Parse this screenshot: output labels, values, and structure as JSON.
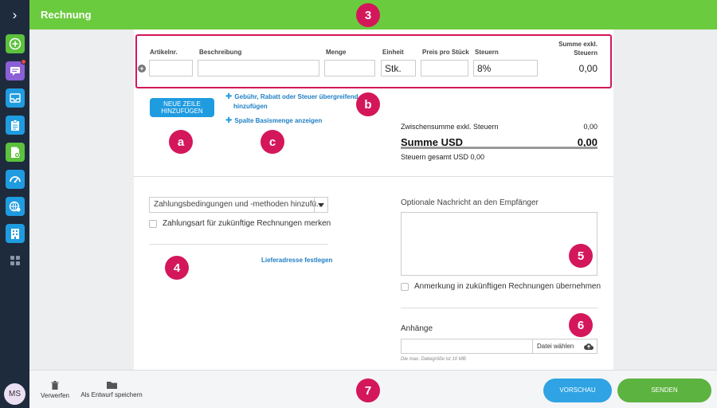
{
  "header": {
    "title": "Rechnung"
  },
  "sidebar": {
    "avatar_initials": "MS"
  },
  "line_items": {
    "columns": {
      "item_no": "Artikelnr.",
      "description": "Beschreibung",
      "quantity": "Menge",
      "unit": "Einheit",
      "unit_price": "Preis pro Stück",
      "tax": "Steuern",
      "sum_line1": "Summe exkl.",
      "sum_line2": "Steuern"
    },
    "row": {
      "item_no": "",
      "description": "",
      "quantity": "",
      "unit": "Stk.",
      "unit_price": "",
      "tax": "8%",
      "sum": "0,00"
    }
  },
  "actions": {
    "add_row_line1": "NEUE ZEILE",
    "add_row_line2": "HINZUFÜGEN",
    "fee_link_line1": "Gebühr, Rabatt oder Steuer übergreifend",
    "fee_link_line2": "hinzufügen",
    "base_qty_link": "Spalte Basismenge anzeigen"
  },
  "totals": {
    "subtotal_label": "Zwischensumme exkl. Steuern",
    "subtotal_value": "0,00",
    "total_label": "Summe USD",
    "total_value": "0,00",
    "tax_total": "Steuern gesamt USD 0,00"
  },
  "payment": {
    "select_value": "Zahlungsbedingungen und -methoden hinzufü...",
    "remember_label": "Zahlungsart für zukünftige Rechnungen merken",
    "shipping_link": "Lieferadresse festlegen"
  },
  "message": {
    "label": "Optionale Nachricht an den Empfänger",
    "remember_label": "Anmerkung in zukünftigen Rechnungen übernehmen"
  },
  "attachments": {
    "label": "Anhänge",
    "choose_file": "Datei wählen",
    "hint": "Die max. Dateigröße ist 10 MB"
  },
  "footer": {
    "discard": "Verwerfen",
    "save_draft": "Als Entwurf speichern",
    "preview": "VORSCHAU",
    "send": "SENDEN"
  },
  "annotations": {
    "a": "a",
    "b": "b",
    "c": "c",
    "n3": "3",
    "n4": "4",
    "n5": "5",
    "n6": "6",
    "n7": "7"
  },
  "colors": {
    "header": "#6bcb3e",
    "sidebar": "#1e2b3d",
    "highlight": "#d4175a",
    "primary_blue": "#1f9be0",
    "send_green": "#5cb340"
  }
}
